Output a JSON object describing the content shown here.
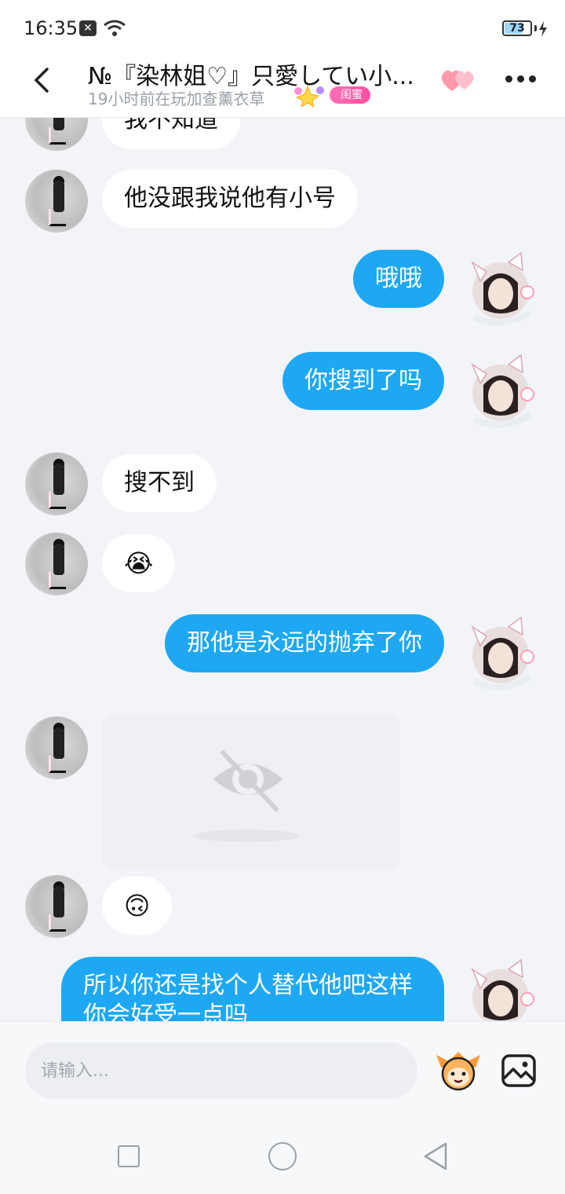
{
  "status_bar": {
    "time": "16:35",
    "x_badge": "✕",
    "battery_level": "73",
    "battery_percent": 73,
    "icons": [
      "close-badge-icon",
      "wifi-icon",
      "battery-icon",
      "charging-icon"
    ]
  },
  "header": {
    "title": "№『染林姐♡』只愛してい小...",
    "subtitle": "19小时前在玩加查薰衣草",
    "badge": "闺蜜",
    "icons": [
      "back-icon",
      "star-badge-icon",
      "hearts-icon",
      "more-icon"
    ]
  },
  "messages": [
    {
      "side": "in",
      "text": "我不知道"
    },
    {
      "side": "in",
      "text": "他没跟我说他有小号"
    },
    {
      "side": "out",
      "text": "哦哦"
    },
    {
      "side": "out",
      "text": "你搜到了吗"
    },
    {
      "side": "in",
      "text": "搜不到"
    },
    {
      "side": "in",
      "emoji": "😭"
    },
    {
      "side": "out",
      "text": "那他是永远的抛弃了你"
    },
    {
      "side": "in",
      "image": "hidden-image-icon"
    },
    {
      "side": "in",
      "emoji": "🙃"
    },
    {
      "side": "out",
      "text": "所以你还是找个人替代他吧这样你会好受一点吗"
    }
  ],
  "input": {
    "placeholder": "请输入...",
    "icons": [
      "sticker-icon",
      "image-icon"
    ]
  },
  "nav": {
    "icons": [
      "recent-apps-icon",
      "home-icon",
      "back-nav-icon"
    ]
  },
  "colors": {
    "accent": "#1ea8f4",
    "background": "#f2f4f8",
    "badge": "#ff4fa3"
  }
}
